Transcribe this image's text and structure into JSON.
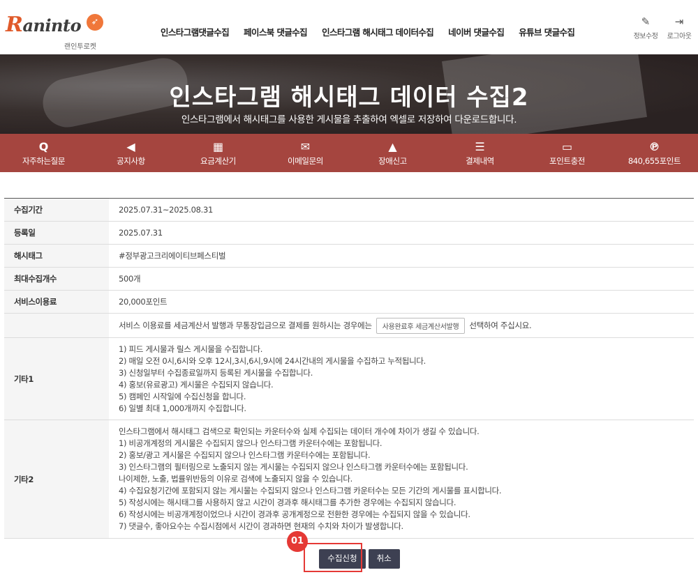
{
  "brand": {
    "logo_main": "R",
    "logo_rest": "aninto",
    "logo_sub": "랜인투로켓",
    "rocket_icon": "rocket-icon"
  },
  "nav": [
    "인스타그램댓글수집",
    "페이스북 댓글수집",
    "인스타그램 해시태그 데이터수집",
    "네이버 댓글수집",
    "유튜브 댓글수집"
  ],
  "user_links": [
    {
      "label": "정보수정",
      "icon": "edit-icon",
      "glyph": "✎"
    },
    {
      "label": "로그아웃",
      "icon": "logout-icon",
      "glyph": "⇥"
    }
  ],
  "hero": {
    "title": "인스타그램 해시태그 데이터 수집2",
    "subtitle": "인스타그램에서 해시태그를 사용한 게시물을 추출하여 엑셀로 저장하여 다운로드합니다."
  },
  "menu": [
    {
      "label": "자주하는질문",
      "icon": "q-icon",
      "glyph": "Q"
    },
    {
      "label": "공지사항",
      "icon": "megaphone-icon",
      "glyph": "📢"
    },
    {
      "label": "요금계산기",
      "icon": "calculator-icon",
      "glyph": "▦"
    },
    {
      "label": "이메일문의",
      "icon": "envelope-icon",
      "glyph": "✉"
    },
    {
      "label": "장애신고",
      "icon": "warning-icon",
      "glyph": "▲"
    },
    {
      "label": "결제내역",
      "icon": "list-icon",
      "glyph": "☰"
    },
    {
      "label": "포인트충전",
      "icon": "card-icon",
      "glyph": "▭"
    },
    {
      "label": "840,655포인트",
      "icon": "pinterest-icon",
      "glyph": "℗"
    }
  ],
  "table": {
    "period_label": "수집기간",
    "period_value": "2025.07.31~2025.08.31",
    "reg_label": "등록일",
    "reg_value": "2025.07.31",
    "hashtag_label": "해시태그",
    "hashtag_value": "#정부광고크리에이티브페스티벌",
    "max_label": "최대수집개수",
    "max_value": "500개",
    "fee_label": "서비스이용료",
    "fee_value": "20,000포인트",
    "tax_pre": "서비스 이용료를 세금계산서 발행과 무통장입금으로 결제를 원하시는 경우에는",
    "tax_btn": "사용완료후 세금계산서발행",
    "tax_post": "선택하여 주십시요.",
    "etc1_label": "기타1",
    "etc1_lines": [
      "1)  피드 게시물과 릴스 게시물을 수집합니다.",
      "2)  매일 오전 0시,6시와 오후 12시,3시,6시,9시에 24시간내의 게시물을 수집하고 누적됩니다.",
      "3)  신청일부터 수집종료일까지 등록된 게시물을 수집합니다.",
      "4)  홍보(유료광고) 게시물은 수집되지 않습니다.",
      "5)  캠페인 시작일에 수집신청을 합니다.",
      "6)  일별 최대 1,000개까지 수집합니다."
    ],
    "etc2_label": "기타2",
    "etc2_lines": [
      "인스타그램에서 해시태그 검색으로 확인되는 카운터수와 실제 수집되는 데이터 개수에 차이가 생길 수 있습니다.",
      "1)  비공개계정의 게시물은 수집되지 않으나 인스타그램 카운터수에는 포함됩니다.",
      "2)  홍보/광고 게시물은 수집되지 않으나 인스타그램 카운터수에는 포함됩니다.",
      "3)  인스타그램의 필터링으로 노출되지 않는 게시물는 수집되지 않으나 인스타그램 카운터수에는 포함됩니다.",
      "     나이제한, 노출, 법률위반등의 이유로 검색에 노출되지 않을 수 있습니다.",
      "4)  수집요청기간에 포함되지 않는 게시물는 수집되지 않으나 인스타그램 카운터수는 모든 기간의 게시물를 표시합니다.",
      "5)  작성시에는 해시태그를 사용하지 않고 시간이 경과후 해시태그를 추가한 경우에는 수집되지 않습니다.",
      "6)  작성시에는 비공개계정이었으나 시간이 경과후 공개계정으로 전환한 경우에는 수집되지 않을 수 있습니다.",
      "7)  댓글수, 좋아요수는 수집시점에서 시간이 경과하면 현재의 수치와 차이가 발생합니다."
    ]
  },
  "buttons": {
    "submit": "수집신청",
    "cancel": "취소"
  },
  "annotation": {
    "step": "01",
    "color": "#e53935"
  }
}
